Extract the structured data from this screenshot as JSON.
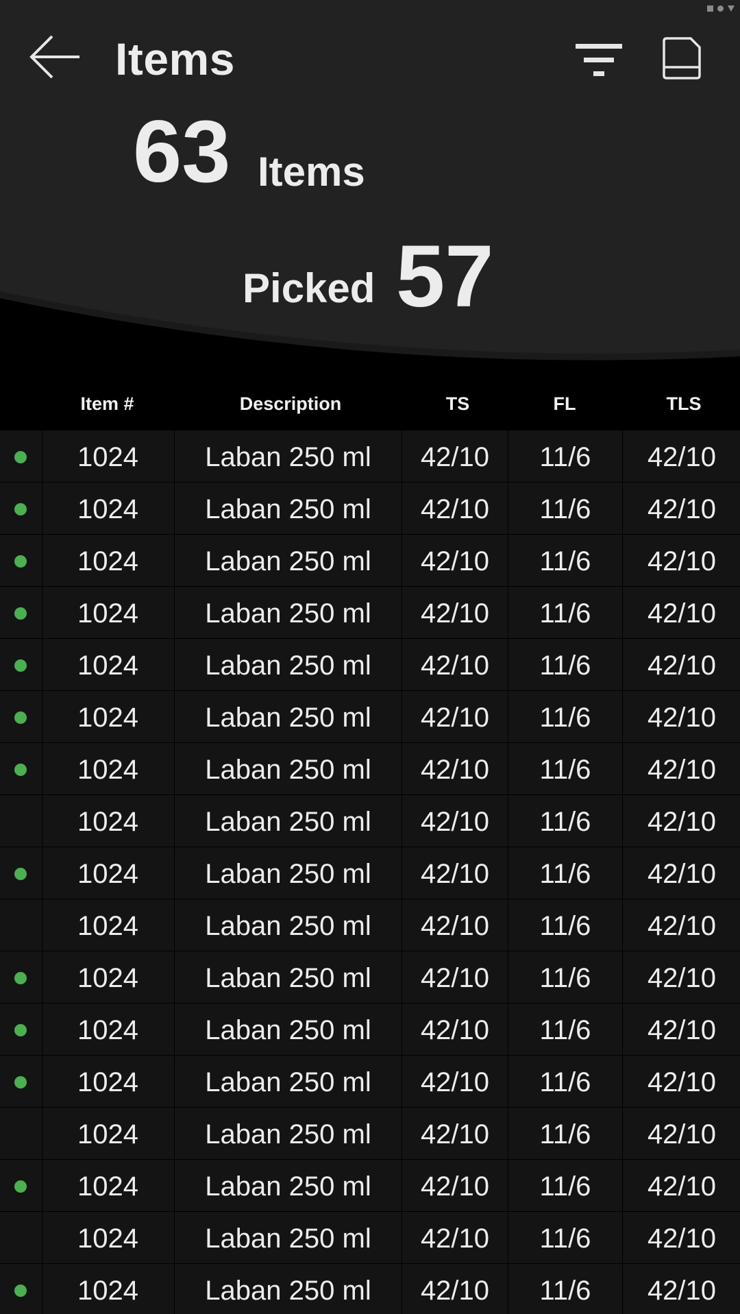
{
  "header": {
    "title": "Items",
    "items_count": "63",
    "items_label": "Items",
    "picked_label": "Picked",
    "picked_count": "57",
    "back_icon": "arrow-left-icon",
    "filter_icon": "filter-icon",
    "save_icon": "floppy-disk-icon"
  },
  "colors": {
    "header_bg": "#222222",
    "page_bg": "#000000",
    "row_bg": "#141414",
    "picked_dot": "#4caf50"
  },
  "table": {
    "columns": [
      "Item #",
      "Description",
      "TS",
      "FL",
      "TLS"
    ],
    "rows": [
      {
        "picked": true,
        "item": "1024",
        "description": "Laban 250 ml",
        "ts": "42/10",
        "fl": "11/6",
        "tls": "42/10"
      },
      {
        "picked": true,
        "item": "1024",
        "description": "Laban 250 ml",
        "ts": "42/10",
        "fl": "11/6",
        "tls": "42/10"
      },
      {
        "picked": true,
        "item": "1024",
        "description": "Laban 250 ml",
        "ts": "42/10",
        "fl": "11/6",
        "tls": "42/10"
      },
      {
        "picked": true,
        "item": "1024",
        "description": "Laban 250 ml",
        "ts": "42/10",
        "fl": "11/6",
        "tls": "42/10"
      },
      {
        "picked": true,
        "item": "1024",
        "description": "Laban 250 ml",
        "ts": "42/10",
        "fl": "11/6",
        "tls": "42/10"
      },
      {
        "picked": true,
        "item": "1024",
        "description": "Laban 250 ml",
        "ts": "42/10",
        "fl": "11/6",
        "tls": "42/10"
      },
      {
        "picked": true,
        "item": "1024",
        "description": "Laban 250 ml",
        "ts": "42/10",
        "fl": "11/6",
        "tls": "42/10"
      },
      {
        "picked": false,
        "item": "1024",
        "description": "Laban 250 ml",
        "ts": "42/10",
        "fl": "11/6",
        "tls": "42/10"
      },
      {
        "picked": true,
        "item": "1024",
        "description": "Laban 250 ml",
        "ts": "42/10",
        "fl": "11/6",
        "tls": "42/10"
      },
      {
        "picked": false,
        "item": "1024",
        "description": "Laban 250 ml",
        "ts": "42/10",
        "fl": "11/6",
        "tls": "42/10"
      },
      {
        "picked": true,
        "item": "1024",
        "description": "Laban 250 ml",
        "ts": "42/10",
        "fl": "11/6",
        "tls": "42/10"
      },
      {
        "picked": true,
        "item": "1024",
        "description": "Laban 250 ml",
        "ts": "42/10",
        "fl": "11/6",
        "tls": "42/10"
      },
      {
        "picked": true,
        "item": "1024",
        "description": "Laban 250 ml",
        "ts": "42/10",
        "fl": "11/6",
        "tls": "42/10"
      },
      {
        "picked": false,
        "item": "1024",
        "description": "Laban 250 ml",
        "ts": "42/10",
        "fl": "11/6",
        "tls": "42/10"
      },
      {
        "picked": true,
        "item": "1024",
        "description": "Laban 250 ml",
        "ts": "42/10",
        "fl": "11/6",
        "tls": "42/10"
      },
      {
        "picked": false,
        "item": "1024",
        "description": "Laban 250 ml",
        "ts": "42/10",
        "fl": "11/6",
        "tls": "42/10"
      },
      {
        "picked": true,
        "item": "1024",
        "description": "Laban 250 ml",
        "ts": "42/10",
        "fl": "11/6",
        "tls": "42/10"
      }
    ]
  }
}
